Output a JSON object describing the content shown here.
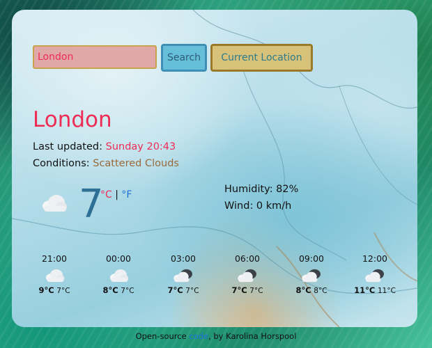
{
  "search": {
    "value": "London",
    "button_label": "Search",
    "location_button_label": "Current Location"
  },
  "current": {
    "city": "London",
    "updated_label": "Last updated:",
    "updated_value": "Sunday 20:43",
    "conditions_label": "Conditions:",
    "conditions_value": "Scattered Clouds",
    "temperature": "7",
    "unit_c": "°C",
    "unit_sep": "|",
    "unit_f": "°F",
    "humidity": "Humidity: 82%",
    "wind": "Wind: 0 km/h",
    "icon": "cloud-icon"
  },
  "forecast": [
    {
      "time": "21:00",
      "max": "9°C",
      "min": "7°C",
      "icon": "cloud-icon"
    },
    {
      "time": "00:00",
      "max": "8°C",
      "min": "7°C",
      "icon": "cloud-icon"
    },
    {
      "time": "03:00",
      "max": "7°C",
      "min": "7°C",
      "icon": "dark-cloud-icon"
    },
    {
      "time": "06:00",
      "max": "7°C",
      "min": "7°C",
      "icon": "dark-cloud-icon"
    },
    {
      "time": "09:00",
      "max": "8°C",
      "min": "8°C",
      "icon": "dark-cloud-icon"
    },
    {
      "time": "12:00",
      "max": "11°C",
      "min": "11°C",
      "icon": "dark-cloud-icon"
    }
  ],
  "footer": {
    "link_text": "code",
    "suffix": ", by Karolina Horspool",
    "prefix": "Open-source"
  },
  "colors": {
    "accent": "#ee2c55",
    "temp_blue": "#2e6f95",
    "link": "#1e6fd9"
  }
}
